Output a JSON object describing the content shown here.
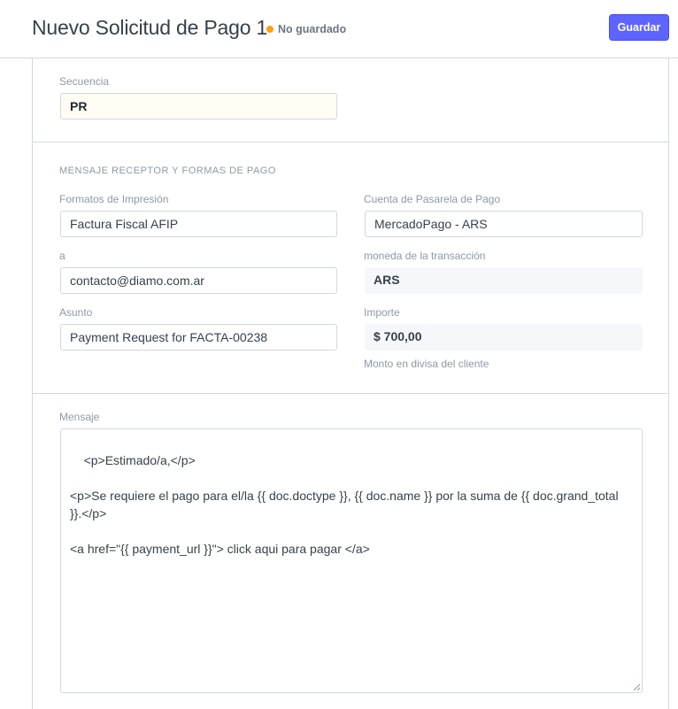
{
  "header": {
    "title": "Nuevo Solicitud de Pago 1",
    "status": "No guardado",
    "status_color": "#ffa00a",
    "save_label": "Guardar",
    "accent": "#5e64ff"
  },
  "sequence": {
    "label": "Secuencia",
    "value": "PR"
  },
  "section_receptor": {
    "heading": "MENSAJE RECEPTOR Y FORMAS DE PAGO",
    "print_format": {
      "label": "Formatos de Impresión",
      "value": "Factura Fiscal AFIP"
    },
    "gateway_account": {
      "label": "Cuenta de Pasarela de Pago",
      "value": "MercadoPago - ARS"
    },
    "to": {
      "label": "a",
      "value": "contacto@diamo.com.ar"
    },
    "currency": {
      "label": "moneda de la transacción",
      "value": "ARS"
    },
    "subject": {
      "label": "Asunto",
      "value": "Payment Request for FACTA-00238"
    },
    "amount": {
      "label": "Importe",
      "value": "$ 700,00",
      "help": "Monto en divisa del cliente"
    }
  },
  "message": {
    "label": "Mensaje",
    "value": "<p>Estimado/a,</p>\n\n<p>Se requiere el pago para el/la {{ doc.doctype }}, {{ doc.name }} por la suma de {{ doc.grand_total }}.</p>\n\n<a href=\"{{ payment_url }}\"> click aqui para pagar </a>"
  }
}
